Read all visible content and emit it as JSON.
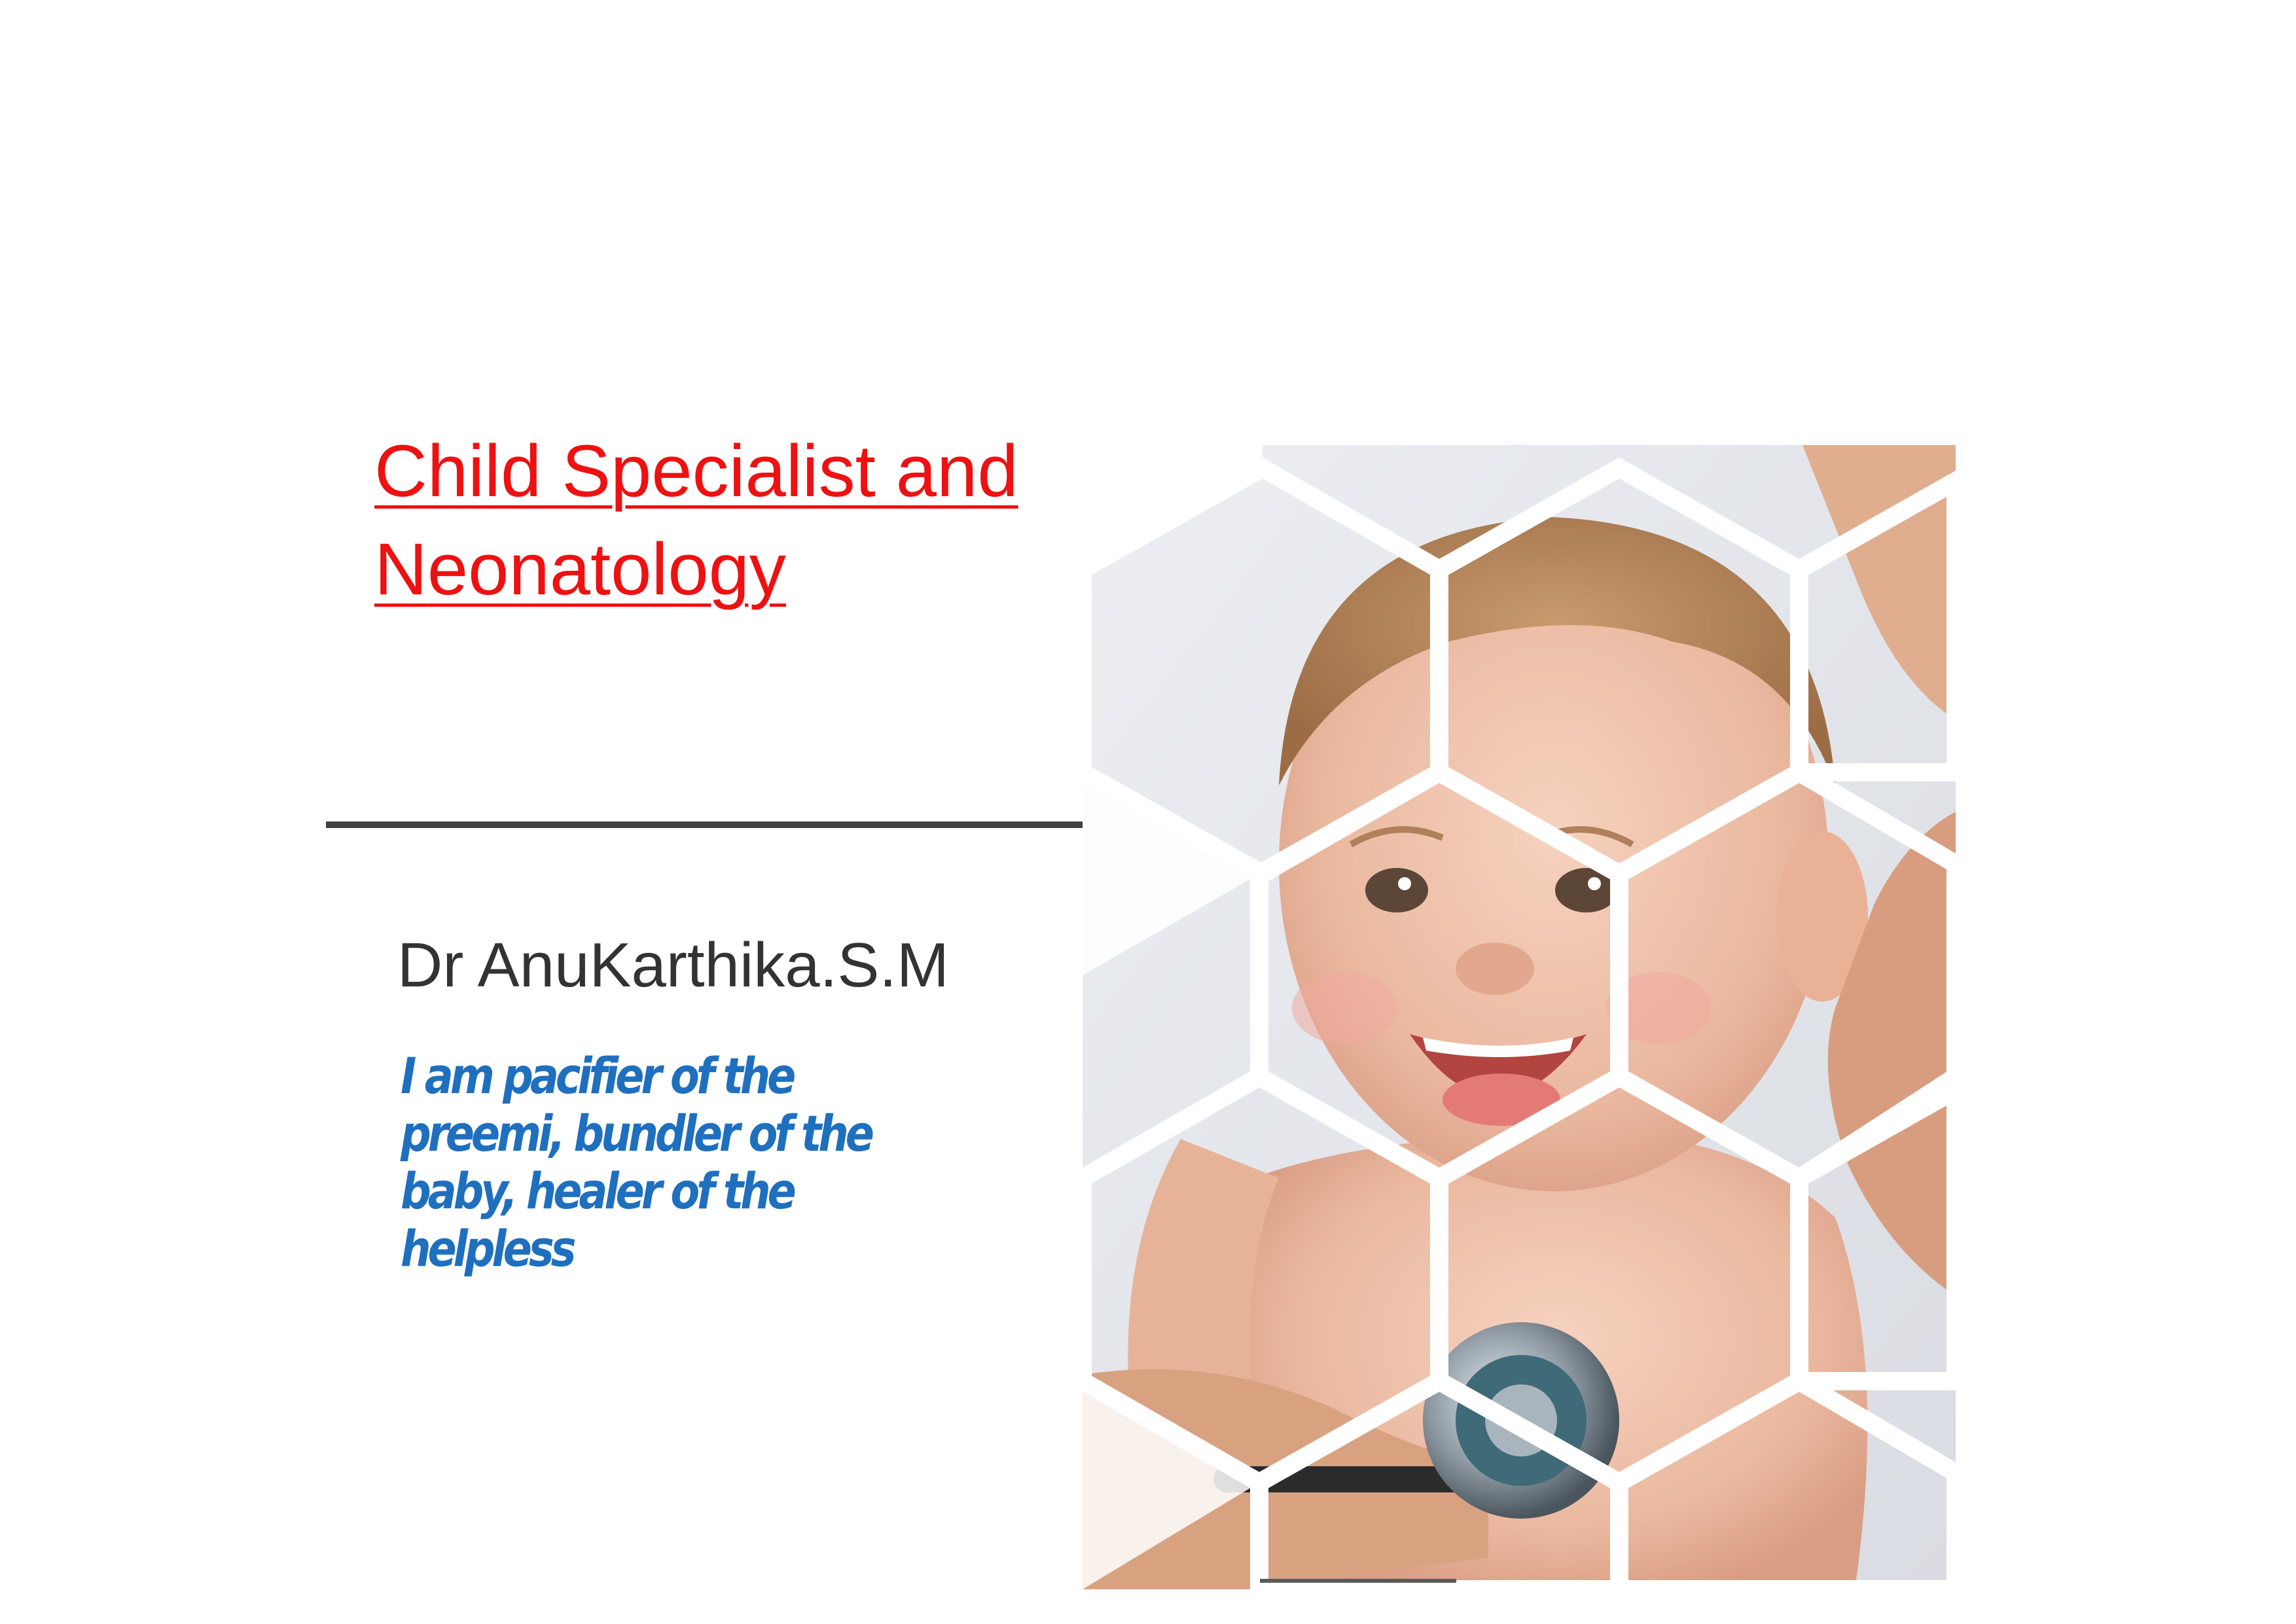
{
  "title": {
    "line1": "Child Specialist and ",
    "line2": "Neonatology"
  },
  "author": "Dr AnuKarthika.S.M",
  "tagline": {
    "line1": "I am pacifier of the",
    "line2": "preemi, bundler of the",
    "line3": "baby, healer of the",
    "line4": "helpless"
  },
  "colors": {
    "title": "#ee1111",
    "tagline": "#1f6fbf",
    "text": "#333333",
    "rule": "#404040"
  },
  "photo": {
    "subject": "smiling-baby-with-stethoscope-icon"
  }
}
